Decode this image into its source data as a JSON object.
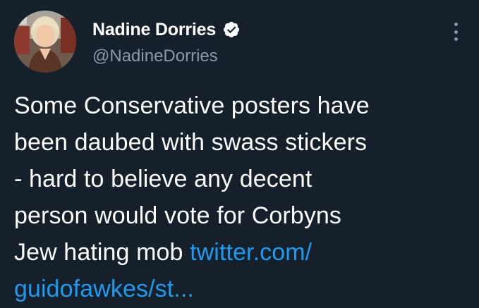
{
  "author": {
    "display_name": "Nadine Dorries",
    "handle": "@NadineDorries",
    "verified": true
  },
  "tweet": {
    "lines": [
      "Some Conservative posters have",
      "been daubed with swass stickers",
      "- hard to believe any decent",
      "person would vote for Corbyns"
    ],
    "last_line_text": "Jew hating mob ",
    "link_part1": "twitter.com/",
    "link_part2": "guidofawkes/st..."
  },
  "icons": {
    "verified": "verified-badge-icon",
    "more": "more-options-icon"
  },
  "colors": {
    "background": "#15202b",
    "text": "#ffffff",
    "secondary_text": "#8b98a5",
    "link": "#1d9bf0"
  }
}
